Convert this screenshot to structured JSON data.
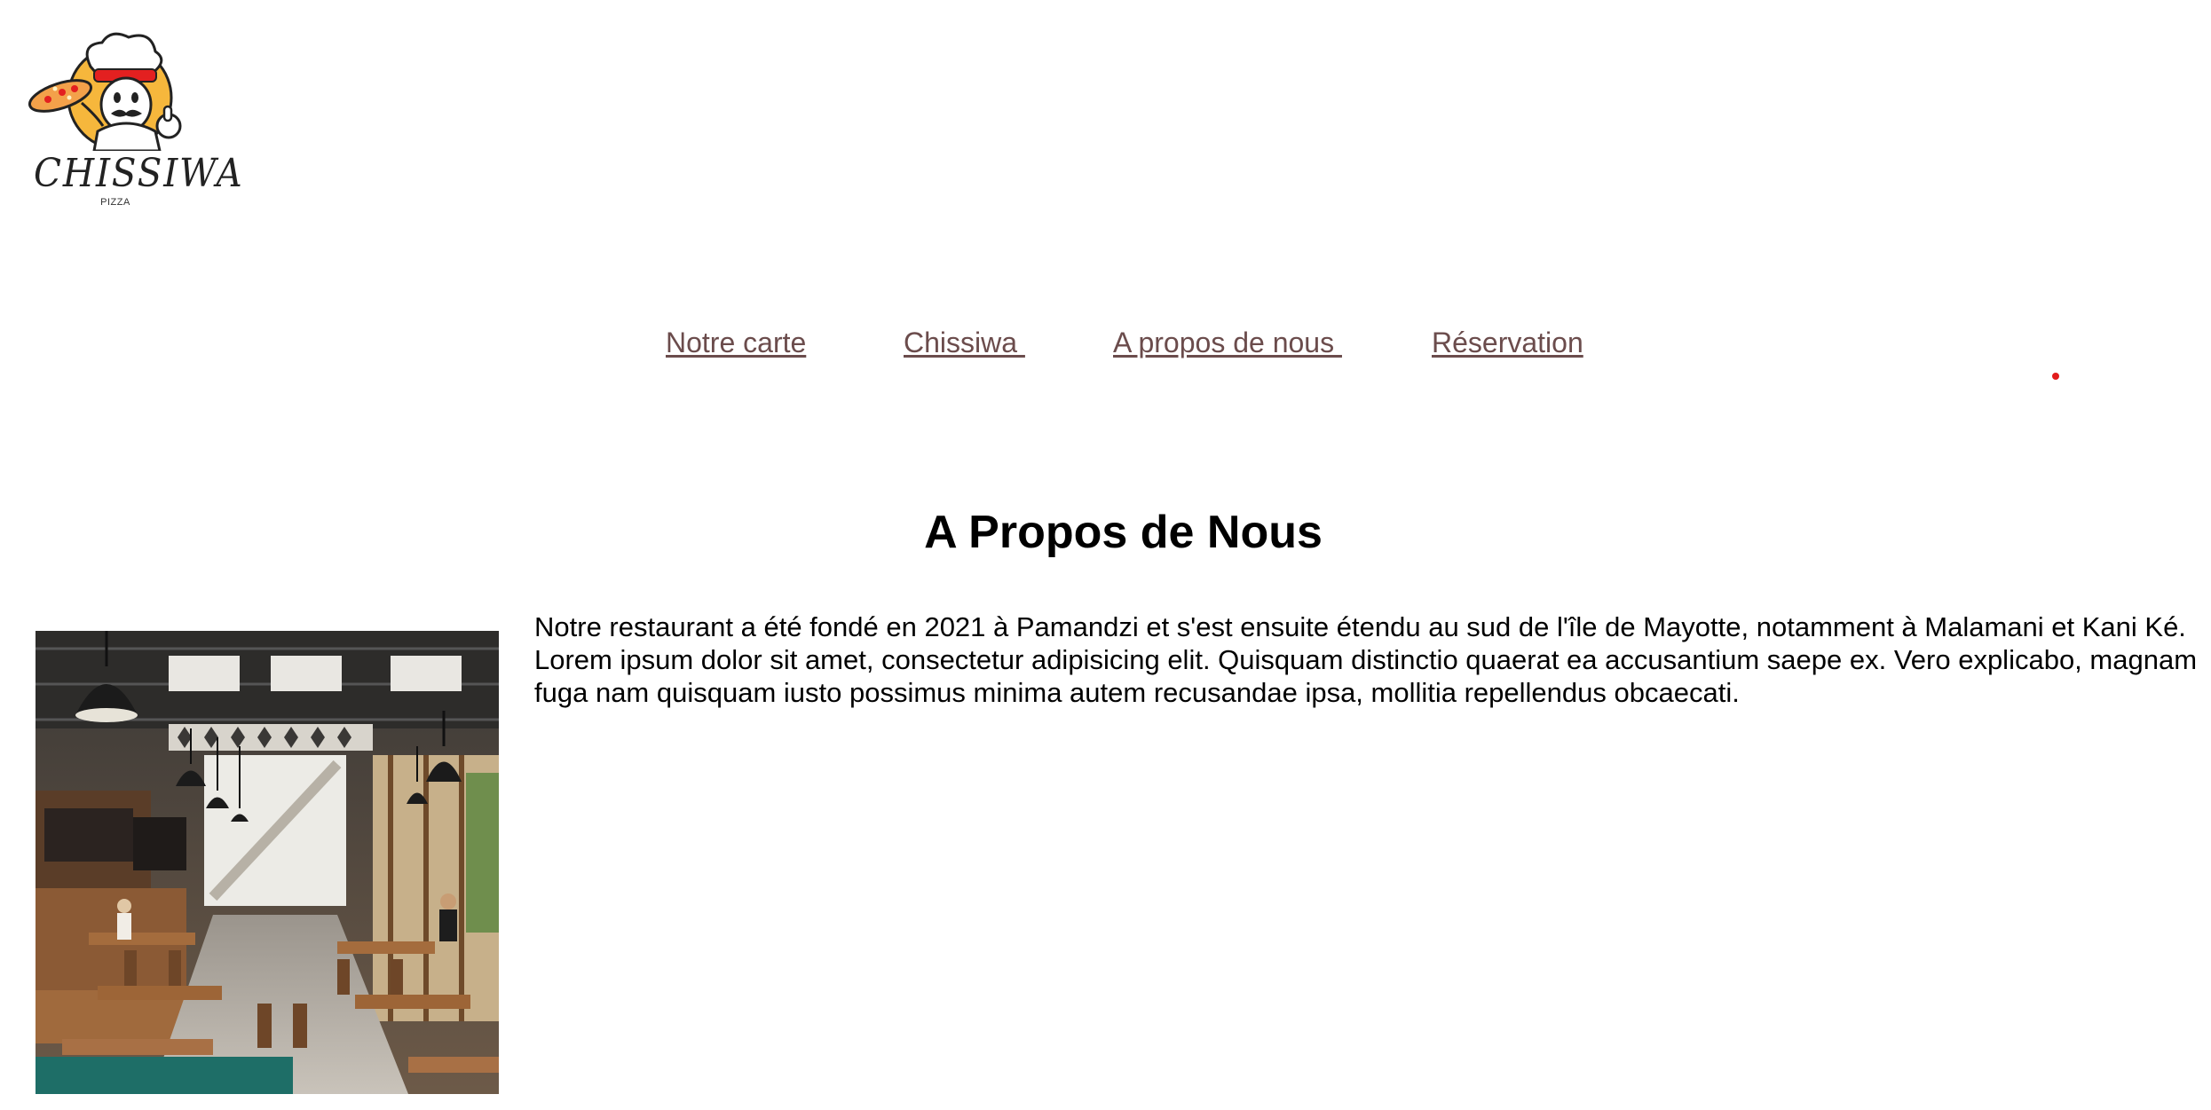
{
  "brand": {
    "name": "CHISSIWA",
    "subtitle": "PIZZA",
    "logo_icon": "chef-pizza-mascot"
  },
  "nav": {
    "items": [
      {
        "label": "Notre carte"
      },
      {
        "label": "Chissiwa "
      },
      {
        "label": "A propos de nous "
      },
      {
        "label": "Réservation"
      }
    ],
    "link_color": "#6b4c4c"
  },
  "about": {
    "title": "A Propos de Nous",
    "image_subject": "restaurant-interior-photo",
    "paragraph_1": "Notre restaurant a été fondé en 2021 à Pamandzi et s'est ensuite étendu au sud de l'île de Mayotte, notamment à Malamani et Kani Ké.",
    "paragraph_2": "Lorem ipsum dolor sit amet, consectetur adipisicing elit. Quisquam distinctio quaerat ea accusantium saepe ex. Vero explicabo, magnam fuga nam quisquam iusto possimus minima autem recusandae ipsa, mollitia repellendus obcaecati."
  },
  "colors": {
    "accent_dot": "#e21b1b",
    "logo_circle": "#f6b73c",
    "chef_bandana": "#e32020"
  }
}
